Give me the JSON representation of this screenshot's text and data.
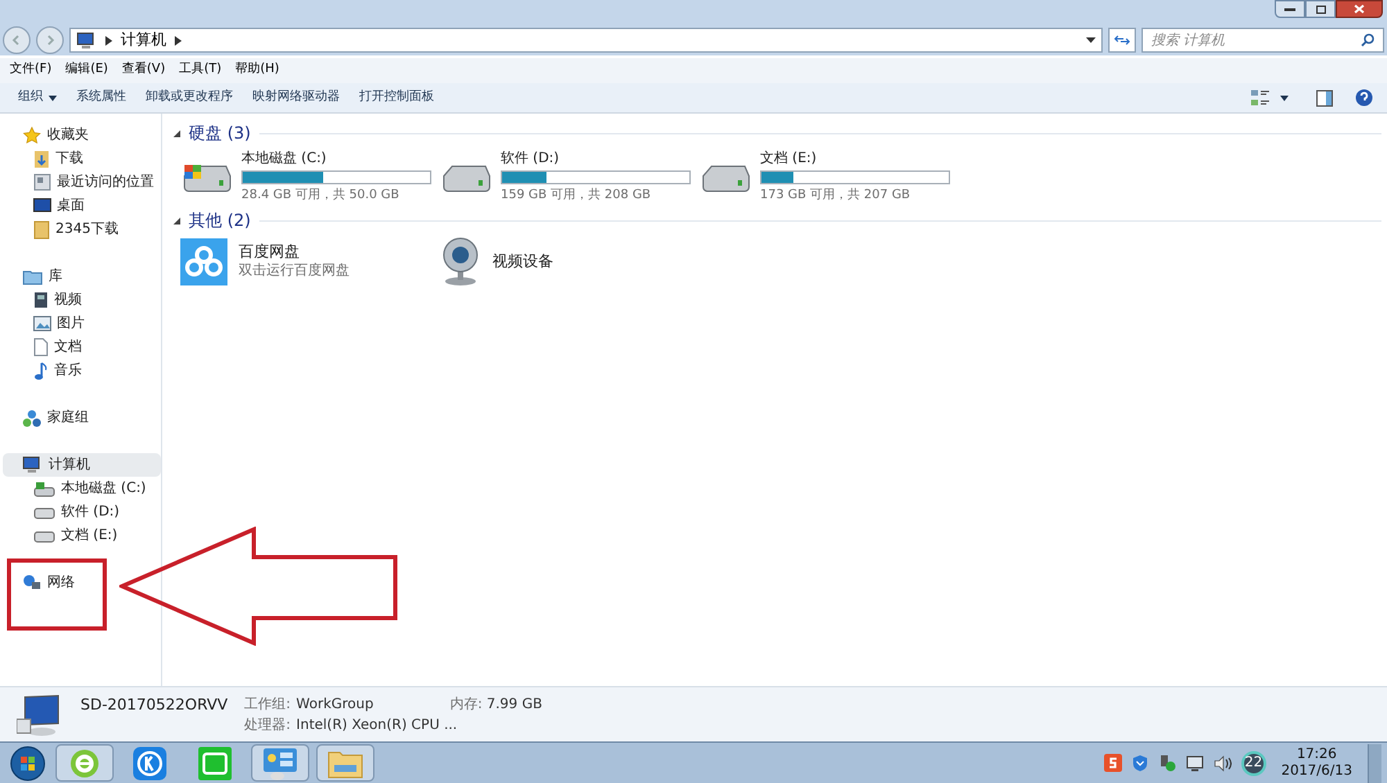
{
  "address_bar": {
    "path": "计算机",
    "search_placeholder": "搜索 计算机"
  },
  "menu_bar": [
    "文件(F)",
    "编辑(E)",
    "查看(V)",
    "工具(T)",
    "帮助(H)"
  ],
  "toolbar": [
    {
      "label": "组织",
      "dropdown": true
    },
    {
      "label": "系统属性",
      "dropdown": false
    },
    {
      "label": "卸载或更改程序",
      "dropdown": false
    },
    {
      "label": "映射网络驱动器",
      "dropdown": false
    },
    {
      "label": "打开控制面板",
      "dropdown": false
    }
  ],
  "sidebar": [
    {
      "label": "收藏夹",
      "kind": "star",
      "selected": false,
      "children": [
        {
          "label": "下载",
          "kind": "download",
          "selected": false
        },
        {
          "label": "最近访问的位置",
          "kind": "recent",
          "selected": false
        },
        {
          "label": "桌面",
          "kind": "desktop",
          "selected": false
        },
        {
          "label": "2345下载",
          "kind": "folder",
          "selected": false
        }
      ]
    },
    {
      "label": "库",
      "kind": "library",
      "selected": false,
      "children": [
        {
          "label": "视频",
          "kind": "video",
          "selected": false
        },
        {
          "label": "图片",
          "kind": "image",
          "selected": false
        },
        {
          "label": "文档",
          "kind": "doc",
          "selected": false
        },
        {
          "label": "音乐",
          "kind": "music",
          "selected": false
        }
      ]
    },
    {
      "label": "家庭组",
      "kind": "homegroup",
      "selected": false
    },
    {
      "label": "计算机",
      "kind": "computer",
      "selected": true,
      "children": [
        {
          "label": "本地磁盘 (C:)",
          "kind": "sysdrive",
          "selected": false
        },
        {
          "label": "软件 (D:)",
          "kind": "drive",
          "selected": false
        },
        {
          "label": "文档 (E:)",
          "kind": "drive",
          "selected": false
        }
      ]
    },
    {
      "label": "网络",
      "kind": "network",
      "selected": false
    }
  ],
  "groups": [
    {
      "title": "硬盘 (3)",
      "items": [
        {
          "kind": "drive",
          "system": true,
          "name": "本地磁盘 (C:)",
          "level": 0.43,
          "info": "28.4 GB 可用，共 50.0 GB"
        },
        {
          "kind": "drive",
          "system": false,
          "name": "软件 (D:)",
          "level": 0.24,
          "info": "159 GB 可用，共 208 GB"
        },
        {
          "kind": "drive",
          "system": false,
          "name": "文档 (E:)",
          "level": 0.17,
          "info": "173 GB 可用，共 207 GB"
        }
      ]
    },
    {
      "title": "其他 (2)",
      "items": [
        {
          "kind": "cloud",
          "name": "百度网盘",
          "info": "双击运行百度网盘"
        },
        {
          "kind": "webcam",
          "name": "视频设备"
        }
      ]
    }
  ],
  "details": {
    "computer_name": "SD-20170522ORVV",
    "workgroup_label": "工作组:",
    "workgroup": "WorkGroup",
    "memory_label": "内存:",
    "memory": "7.99 GB",
    "cpu_label": "处理器:",
    "cpu": "Intel(R) Xeon(R) CPU ..."
  },
  "taskbar": [
    {
      "kind": "ie",
      "running": true
    },
    {
      "kind": "kugou",
      "running": false
    },
    {
      "kind": "iqiyi",
      "running": false
    },
    {
      "kind": "control-panel",
      "running": true
    },
    {
      "kind": "explorer",
      "running": true
    }
  ],
  "tray": {
    "badge": "22",
    "time": "17:26",
    "date": "2017/6/13"
  }
}
